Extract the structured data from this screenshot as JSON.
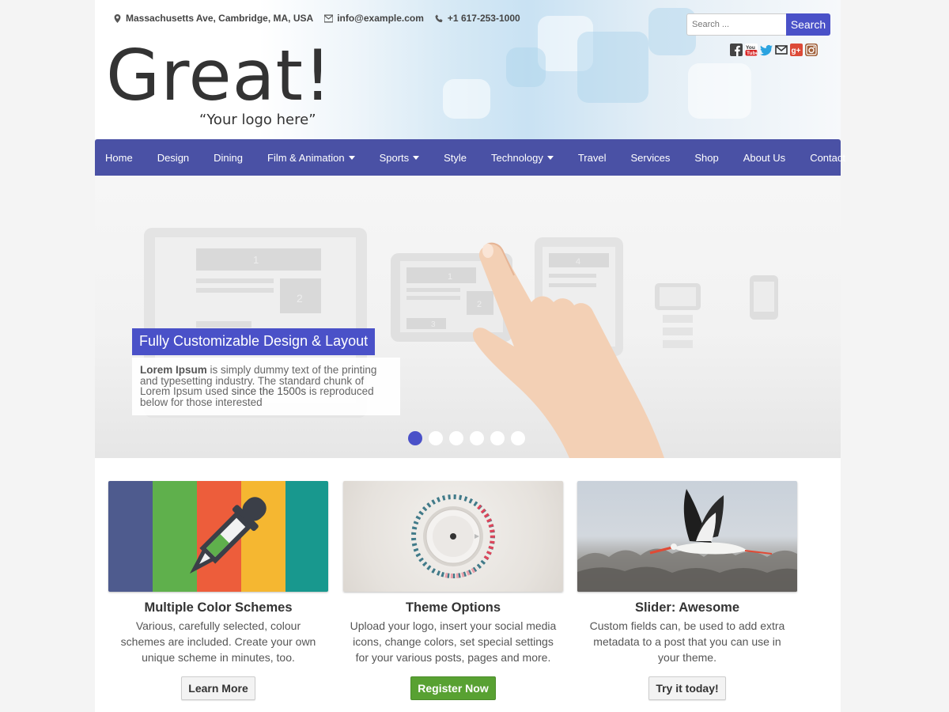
{
  "contact": {
    "address": "Massachusetts Ave, Cambridge, MA, USA",
    "email": "info@example.com",
    "phone": "+1 617-253-1000"
  },
  "search": {
    "placeholder": "Search ...",
    "button": "Search"
  },
  "social_icons": [
    "facebook-icon",
    "youtube-icon",
    "twitter-icon",
    "mail-icon",
    "google-plus-icon",
    "instagram-icon"
  ],
  "logo": {
    "title": "Great!",
    "tagline": "“Your logo here”"
  },
  "nav": [
    {
      "label": "Home"
    },
    {
      "label": "Design"
    },
    {
      "label": "Dining"
    },
    {
      "label": "Film & Animation",
      "dropdown": true
    },
    {
      "label": "Sports",
      "dropdown": true
    },
    {
      "label": "Style"
    },
    {
      "label": "Technology",
      "dropdown": true
    },
    {
      "label": "Travel"
    },
    {
      "label": "Services"
    },
    {
      "label": "Shop"
    },
    {
      "label": "About Us"
    },
    {
      "label": "Contact"
    }
  ],
  "slider": {
    "caption_title": "Fully Customizable Design & Layout",
    "caption_strong1": "Lorem Ipsum",
    "caption_text1": " is simply dummy text of the printing and typesetting industry. The standard chunk of Lorem Ipsum used ",
    "caption_strong2": "since the 1500s",
    "caption_text2": " is reproduced below for those interested",
    "slide_count": 6,
    "active_slide": 1,
    "mockup_labels": [
      "1",
      "2",
      "3",
      "4"
    ]
  },
  "features": [
    {
      "title": "Multiple Color Schemes",
      "text": "Various, carefully selected, colour schemes are included. Create your own unique scheme in minutes, too.",
      "button": "Learn More"
    },
    {
      "title": "Theme Options",
      "text": "Upload your logo, insert your social media icons, change colors, set special settings for your various posts, pages and more.",
      "button": "Register Now"
    },
    {
      "title": "Slider: Awesome",
      "text": "Custom fields can, be used to add extra metadata to a post that you can use in your theme.",
      "button": "Try it today!"
    }
  ],
  "colors": {
    "accent": "#4a51c8",
    "nav": "#4a51a5",
    "green_button": "#58a132"
  }
}
